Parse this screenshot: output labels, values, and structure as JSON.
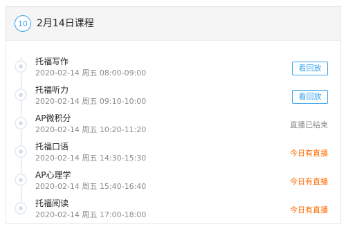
{
  "header": {
    "day_number": "10",
    "title": "2月14日课程"
  },
  "colors": {
    "accent": "#3aa3ee",
    "live": "#ff6a00",
    "muted": "#8a8a8a"
  },
  "courses": [
    {
      "title": "托福写作",
      "time": "2020-02-14 周五 08:00-09:00",
      "action": "看回放",
      "status": "replay"
    },
    {
      "title": "托福听力",
      "time": "2020-02-14 周五 09:10-10:00",
      "action": "看回放",
      "status": "replay"
    },
    {
      "title": "AP微积分",
      "time": "2020-02-14 周五 10:20-11:20",
      "action": "直播已结束",
      "status": "ended"
    },
    {
      "title": "托福口语",
      "time": "2020-02-14 周五 14:30-15:30",
      "action": "今日有直播",
      "status": "live"
    },
    {
      "title": "AP心理学",
      "time": "2020-02-14 周五 15:40-16:40",
      "action": "今日有直播",
      "status": "live"
    },
    {
      "title": "托福阅读",
      "time": "2020-02-14 周五 17:00-18:00",
      "action": "今日有直播",
      "status": "live"
    }
  ]
}
